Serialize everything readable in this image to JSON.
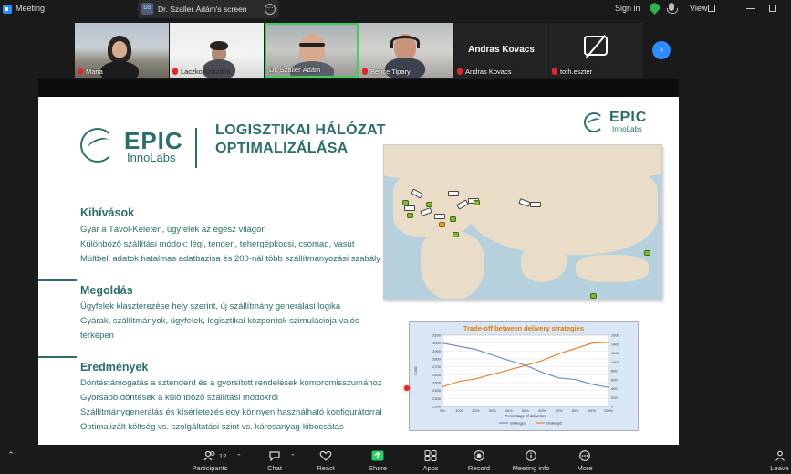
{
  "app": {
    "title": "Meeting"
  },
  "share": {
    "badge": "DS",
    "label": "Dr. Szaller Ádám's screen",
    "more": "⋯"
  },
  "header": {
    "signin": "Sign in",
    "view": "View"
  },
  "participants": [
    {
      "name": "Maria",
      "muted": true
    },
    {
      "name": "Laczko Krisztina",
      "muted": true
    },
    {
      "name": "Dr. Szaller Ádám",
      "muted": true,
      "active": true
    },
    {
      "name": "Bence Tipary",
      "muted": true
    },
    {
      "name": "Andras Kovacs",
      "muted": true,
      "display_name": "Andras Kovacs"
    },
    {
      "name": "toth.eszter",
      "muted": true
    }
  ],
  "strip": {
    "next_icon": "›"
  },
  "slide": {
    "logo_word": "EPIC",
    "logo_sub": "InnoLabs",
    "title_line1": "LOGISZTIKAI HÁLÓZAT",
    "title_line2": "OPTIMALIZÁLÁSA",
    "sections": [
      {
        "heading": "Kihívások",
        "lines": [
          "Gyár a Távol-Keleten, ügyfelek az egész világon",
          "Különböző szállítási módok: légi, tengeri, tehergépkocsi, csomag, vasút",
          "Múltbeli adatok hatalmas adatbázisa és 200-nál több szállítmányozási szabály"
        ]
      },
      {
        "heading": "Megoldás",
        "lines": [
          "Ügyfelek klaszterezése hely szerint, új szállítmány generálási logika",
          "Gyárak, szállítmányok, ügyfelek, logisztikai központok szimulációja valós",
          "térképen"
        ]
      },
      {
        "heading": "Eredmények",
        "lines": [
          "Döntéstámogatás a sztenderd és a gyorsított rendelések kompromisszumához",
          "Gyorsabb döntések a különböző szállítási módokról",
          "Szállítmánygenerálás és kísérletezés egy könnyen használható konfigurátorral",
          "Optimalizált költség vs. szolgáltatási szint vs. károsanyag-kibocsátás"
        ]
      }
    ]
  },
  "chart_data": {
    "type": "line",
    "title": "Trade-off between delivery strategies",
    "xlabel": "Percentage of deliveries",
    "ylabel": "Cost",
    "categories": [
      "0%",
      "10%",
      "20%",
      "30%",
      "40%",
      "50%",
      "60%",
      "70%",
      "80%",
      "90%",
      "100%"
    ],
    "ylim": [
      2200,
      3100
    ],
    "y_ticks": [
      3100,
      3000,
      2900,
      2800,
      2700,
      2600,
      2500,
      2400,
      2300,
      2200
    ],
    "y2lim": [
      0,
      1600
    ],
    "y2_ticks": [
      1600,
      1400,
      1200,
      1000,
      800,
      600,
      400,
      200,
      0
    ],
    "series": [
      {
        "name": "Strategy1",
        "axis": "left",
        "color": "#6d8fc9",
        "values": [
          3000,
          2960,
          2920,
          2850,
          2780,
          2720,
          2630,
          2560,
          2540,
          2480,
          2440
        ]
      },
      {
        "name": "Strategy2",
        "axis": "right",
        "color": "#e8822c",
        "values": [
          440,
          560,
          620,
          720,
          820,
          920,
          1030,
          1180,
          1300,
          1420,
          1440
        ]
      }
    ]
  },
  "toolbar": {
    "participants_label": "Participants",
    "participants_count": "12",
    "chat_label": "Chat",
    "react_label": "React",
    "share_label": "Share",
    "apps_label": "Apps",
    "record_label": "Record",
    "meeting_info_label": "Meeting info",
    "more_label": "More",
    "leave_label": "Leave"
  },
  "colors": {
    "accent": "#2d8cff",
    "brand": "#2a6f6a",
    "active_border": "#3fcf5a",
    "muted_red": "#e02828"
  }
}
